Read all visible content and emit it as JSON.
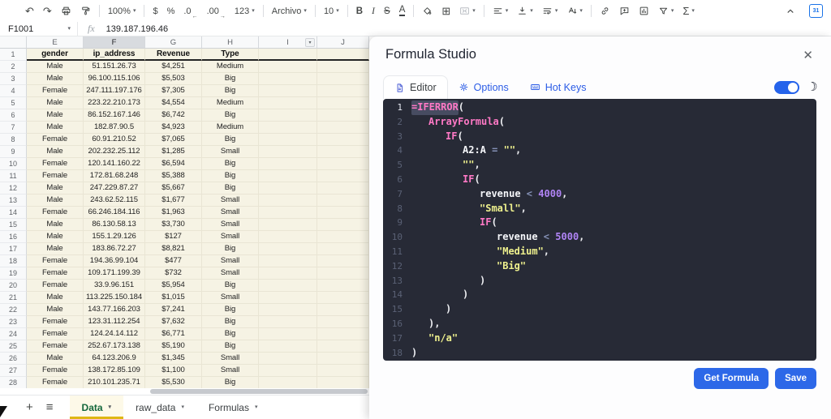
{
  "toolbar": {
    "items": [
      {
        "name": "undo",
        "glyph": "↶"
      },
      {
        "name": "redo",
        "glyph": "↷"
      },
      {
        "name": "print",
        "icon": "printer-icon"
      },
      {
        "name": "paint-format",
        "icon": "paint-roller-icon"
      },
      {
        "sep": true
      },
      {
        "name": "zoom",
        "label": "100%",
        "dropdown": true
      },
      {
        "sep": true
      },
      {
        "name": "format-as-currency",
        "label": "$"
      },
      {
        "name": "format-as-percent",
        "label": "%"
      },
      {
        "name": "decrease-decimal-places",
        "label": ".0",
        "arrow": "←"
      },
      {
        "name": "increase-decimal-places",
        "label": ".00",
        "arrow": "→"
      },
      {
        "name": "more-formats",
        "label": "123",
        "dropdown": true
      },
      {
        "sep": true
      },
      {
        "name": "font",
        "label": "Archivo",
        "dropdown": true,
        "wide": true
      },
      {
        "sep": true
      },
      {
        "name": "font-size",
        "label": "10",
        "dropdown": true
      },
      {
        "sep": true
      },
      {
        "name": "bold",
        "label": "B",
        "style": "bold"
      },
      {
        "name": "italic",
        "label": "I",
        "style": "italic"
      },
      {
        "name": "strikethrough",
        "label": "S",
        "style": "strike"
      },
      {
        "name": "text-color",
        "label": "A",
        "style": "textcolor"
      },
      {
        "sep": true
      },
      {
        "name": "fill-color",
        "icon": "fill-bucket-icon"
      },
      {
        "name": "borders",
        "glyph": "⊞"
      },
      {
        "name": "merge-cells",
        "icon": "merge-cells-icon",
        "dropdown": true,
        "disabled": true
      },
      {
        "sep": true
      },
      {
        "name": "horizontal-align",
        "icon": "align-left-icon",
        "dropdown": true
      },
      {
        "name": "vertical-align",
        "icon": "vertical-align-icon",
        "dropdown": true
      },
      {
        "name": "text-wrap",
        "icon": "text-wrap-icon",
        "dropdown": true
      },
      {
        "name": "text-rotation",
        "icon": "text-rotation-icon",
        "dropdown": true
      },
      {
        "sep": true
      },
      {
        "name": "insert-link",
        "icon": "link-icon"
      },
      {
        "name": "insert-comment",
        "icon": "comment-icon"
      },
      {
        "name": "insert-chart",
        "icon": "chart-icon"
      },
      {
        "name": "create-filter",
        "icon": "filter-icon",
        "dropdown": true
      },
      {
        "name": "functions",
        "glyph": "Σ",
        "dropdown": true
      }
    ],
    "calendar_badge": "31"
  },
  "formula_bar": {
    "name_box": "F1001",
    "fx": "fx",
    "value": "139.187.196.46"
  },
  "grid": {
    "columns": [
      "E",
      "F",
      "G",
      "H",
      "I",
      "J"
    ],
    "selected_column": "F",
    "column_menu_on": "I",
    "header_row": [
      "gender",
      "ip_address",
      "Revenue",
      "Type"
    ],
    "rows": [
      [
        "Male",
        "51.151.26.73",
        "$4,251",
        "Medium"
      ],
      [
        "Male",
        "96.100.115.106",
        "$5,503",
        "Big"
      ],
      [
        "Female",
        "247.111.197.176",
        "$7,305",
        "Big"
      ],
      [
        "Male",
        "223.22.210.173",
        "$4,554",
        "Medium"
      ],
      [
        "Male",
        "86.152.167.146",
        "$6,742",
        "Big"
      ],
      [
        "Male",
        "182.87.90.5",
        "$4,923",
        "Medium"
      ],
      [
        "Female",
        "60.91.210.52",
        "$7,065",
        "Big"
      ],
      [
        "Male",
        "202.232.25.112",
        "$1,285",
        "Small"
      ],
      [
        "Female",
        "120.141.160.22",
        "$6,594",
        "Big"
      ],
      [
        "Female",
        "172.81.68.248",
        "$5,388",
        "Big"
      ],
      [
        "Male",
        "247.229.87.27",
        "$5,667",
        "Big"
      ],
      [
        "Male",
        "243.62.52.115",
        "$1,677",
        "Small"
      ],
      [
        "Female",
        "66.246.184.116",
        "$1,963",
        "Small"
      ],
      [
        "Male",
        "86.130.58.13",
        "$3,730",
        "Small"
      ],
      [
        "Male",
        "155.1.29.126",
        "$127",
        "Small"
      ],
      [
        "Male",
        "183.86.72.27",
        "$8,821",
        "Big"
      ],
      [
        "Female",
        "194.36.99.104",
        "$477",
        "Small"
      ],
      [
        "Female",
        "109.171.199.39",
        "$732",
        "Small"
      ],
      [
        "Female",
        "33.9.96.151",
        "$5,954",
        "Big"
      ],
      [
        "Male",
        "113.225.150.184",
        "$1,015",
        "Small"
      ],
      [
        "Male",
        "143.77.166.203",
        "$7,241",
        "Big"
      ],
      [
        "Female",
        "123.31.112.254",
        "$7,632",
        "Big"
      ],
      [
        "Female",
        "124.24.14.112",
        "$6,771",
        "Big"
      ],
      [
        "Female",
        "252.67.173.138",
        "$5,190",
        "Big"
      ],
      [
        "Male",
        "64.123.206.9",
        "$1,345",
        "Small"
      ],
      [
        "Female",
        "138.172.85.109",
        "$1,100",
        "Small"
      ],
      [
        "Female",
        "210.101.235.71",
        "$5,530",
        "Big"
      ]
    ]
  },
  "sheet_bar": {
    "add_sheet": "+",
    "all_sheets": "≡",
    "tabs": [
      {
        "label": "Data",
        "active": true
      },
      {
        "label": "raw_data",
        "active": false
      },
      {
        "label": "Formulas",
        "active": false
      }
    ]
  },
  "panel": {
    "title": "Formula Studio",
    "close_icon": "✕",
    "accent_color": "#2d68e8",
    "tabs": [
      {
        "label": "Editor",
        "icon": "document-icon",
        "active": true
      },
      {
        "label": "Options",
        "icon": "gear-icon",
        "active": false
      },
      {
        "label": "Hot Keys",
        "icon": "keyboard-icon",
        "active": false
      }
    ],
    "dark_mode_toggle_on": true,
    "editor_theme": {
      "background": "#272a36",
      "function": "#ff79c6",
      "string": "#eef08d",
      "number": "#b084f5",
      "operator": "#8490b5",
      "text": "#f5f6fa"
    },
    "code": {
      "lines": [
        {
          "n": 1,
          "indent": 0,
          "active": true,
          "tokens": [
            {
              "t": "=IFERROR",
              "c": "fn hl"
            },
            {
              "t": "(",
              "c": "pn"
            }
          ]
        },
        {
          "n": 2,
          "indent": 1,
          "tokens": [
            {
              "t": "ArrayFormula",
              "c": "fn"
            },
            {
              "t": "(",
              "c": "pn"
            }
          ]
        },
        {
          "n": 3,
          "indent": 2,
          "tokens": [
            {
              "t": "IF",
              "c": "fn"
            },
            {
              "t": "(",
              "c": "pn"
            }
          ]
        },
        {
          "n": 4,
          "indent": 3,
          "tokens": [
            {
              "t": "A2:A",
              "c": "id"
            },
            {
              "t": " = ",
              "c": "op"
            },
            {
              "t": "\"\"",
              "c": "str"
            },
            {
              "t": ",",
              "c": "pn"
            }
          ]
        },
        {
          "n": 5,
          "indent": 3,
          "tokens": [
            {
              "t": "\"\"",
              "c": "str"
            },
            {
              "t": ",",
              "c": "pn"
            }
          ]
        },
        {
          "n": 6,
          "indent": 3,
          "tokens": [
            {
              "t": "IF",
              "c": "fn"
            },
            {
              "t": "(",
              "c": "pn"
            }
          ]
        },
        {
          "n": 7,
          "indent": 4,
          "tokens": [
            {
              "t": "revenue",
              "c": "id"
            },
            {
              "t": " < ",
              "c": "op"
            },
            {
              "t": "4000",
              "c": "num"
            },
            {
              "t": ",",
              "c": "pn"
            }
          ]
        },
        {
          "n": 8,
          "indent": 4,
          "tokens": [
            {
              "t": "\"Small\"",
              "c": "str"
            },
            {
              "t": ",",
              "c": "pn"
            }
          ]
        },
        {
          "n": 9,
          "indent": 4,
          "tokens": [
            {
              "t": "IF",
              "c": "fn"
            },
            {
              "t": "(",
              "c": "pn"
            }
          ]
        },
        {
          "n": 10,
          "indent": 5,
          "tokens": [
            {
              "t": "revenue",
              "c": "id"
            },
            {
              "t": " < ",
              "c": "op"
            },
            {
              "t": "5000",
              "c": "num"
            },
            {
              "t": ",",
              "c": "pn"
            }
          ]
        },
        {
          "n": 11,
          "indent": 5,
          "tokens": [
            {
              "t": "\"Medium\"",
              "c": "str"
            },
            {
              "t": ",",
              "c": "pn"
            }
          ]
        },
        {
          "n": 12,
          "indent": 5,
          "tokens": [
            {
              "t": "\"Big\"",
              "c": "str"
            }
          ]
        },
        {
          "n": 13,
          "indent": 4,
          "tokens": [
            {
              "t": ")",
              "c": "pn"
            }
          ]
        },
        {
          "n": 14,
          "indent": 3,
          "tokens": [
            {
              "t": ")",
              "c": "pn"
            }
          ]
        },
        {
          "n": 15,
          "indent": 2,
          "tokens": [
            {
              "t": ")",
              "c": "pn"
            }
          ]
        },
        {
          "n": 16,
          "indent": 1,
          "tokens": [
            {
              "t": "),",
              "c": "pn"
            }
          ]
        },
        {
          "n": 17,
          "indent": 1,
          "tokens": [
            {
              "t": "\"n/a\"",
              "c": "str"
            }
          ]
        },
        {
          "n": 18,
          "indent": 0,
          "tokens": [
            {
              "t": ")",
              "c": "pn"
            }
          ]
        }
      ]
    },
    "buttons": [
      {
        "label": "Get Formula",
        "name": "get-formula-button"
      },
      {
        "label": "Save",
        "name": "save-button"
      }
    ]
  }
}
